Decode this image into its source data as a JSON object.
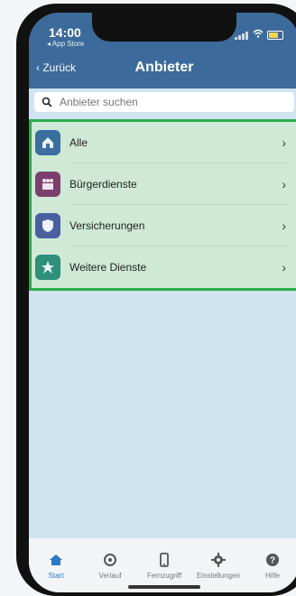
{
  "status": {
    "time": "14:00",
    "back_app": "◂ App Store"
  },
  "nav": {
    "back_label": "Zurück",
    "title": "Anbieter"
  },
  "search": {
    "placeholder": "Anbieter suchen"
  },
  "providers": [
    {
      "label": "Alle",
      "icon": "house-icon",
      "color": "#3a6fa0"
    },
    {
      "label": "Bürgerdienste",
      "icon": "people-icon",
      "color": "#7b3f6e"
    },
    {
      "label": "Versicherungen",
      "icon": "shield-icon",
      "color": "#4a5fa0"
    },
    {
      "label": "Weitere Dienste",
      "icon": "star-icon",
      "color": "#2e8f7b"
    }
  ],
  "tabbar": {
    "items": [
      {
        "label": "Start",
        "icon": "home-icon",
        "active": true
      },
      {
        "label": "Verlauf",
        "icon": "history-icon",
        "active": false
      },
      {
        "label": "Fernzugriff",
        "icon": "phone-icon",
        "active": false
      },
      {
        "label": "Einstellungen",
        "icon": "gear-icon",
        "active": false
      },
      {
        "label": "Hilfe",
        "icon": "help-icon",
        "active": false
      }
    ]
  },
  "colors": {
    "accent": "#2b78c4",
    "highlight_border": "#2cab4b",
    "header": "#3c6a9a"
  }
}
